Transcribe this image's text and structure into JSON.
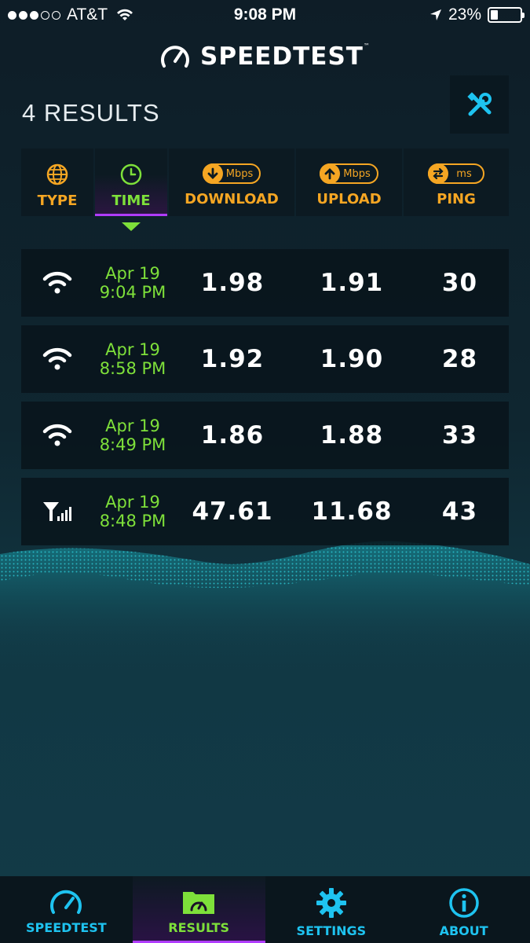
{
  "status_bar": {
    "carrier": "AT&T",
    "time": "9:08 PM",
    "battery": "23%"
  },
  "app": {
    "logo_text": "SPEEDTEST",
    "trademark": "™"
  },
  "results_title": "4 RESULTS",
  "header": {
    "type": "TYPE",
    "time": "TIME",
    "download": "DOWNLOAD",
    "download_unit": "Mbps",
    "upload": "UPLOAD",
    "upload_unit": "Mbps",
    "ping": "PING",
    "ping_unit": "ms",
    "active_sort": "TIME"
  },
  "results": [
    {
      "type": "wifi-icon",
      "date": "Apr 19",
      "time": "9:04 PM",
      "download": "1.98",
      "upload": "1.91",
      "ping": "30"
    },
    {
      "type": "wifi-icon",
      "date": "Apr 19",
      "time": "8:58 PM",
      "download": "1.92",
      "upload": "1.90",
      "ping": "28"
    },
    {
      "type": "wifi-icon",
      "date": "Apr 19",
      "time": "8:49 PM",
      "download": "1.86",
      "upload": "1.88",
      "ping": "33"
    },
    {
      "type": "cellular-icon",
      "date": "Apr 19",
      "time": "8:48 PM",
      "download": "47.61",
      "upload": "11.68",
      "ping": "43"
    }
  ],
  "tabs": [
    {
      "label": "SPEEDTEST",
      "icon": "gauge-icon"
    },
    {
      "label": "RESULTS",
      "icon": "results-folder-icon",
      "active": true
    },
    {
      "label": "SETTINGS",
      "icon": "gear-icon"
    },
    {
      "label": "ABOUT",
      "icon": "info-icon"
    }
  ],
  "colors": {
    "accent_orange": "#f5a623",
    "accent_green": "#7ee03a",
    "accent_blue": "#1ec3f0",
    "accent_purple": "#b03cff"
  }
}
